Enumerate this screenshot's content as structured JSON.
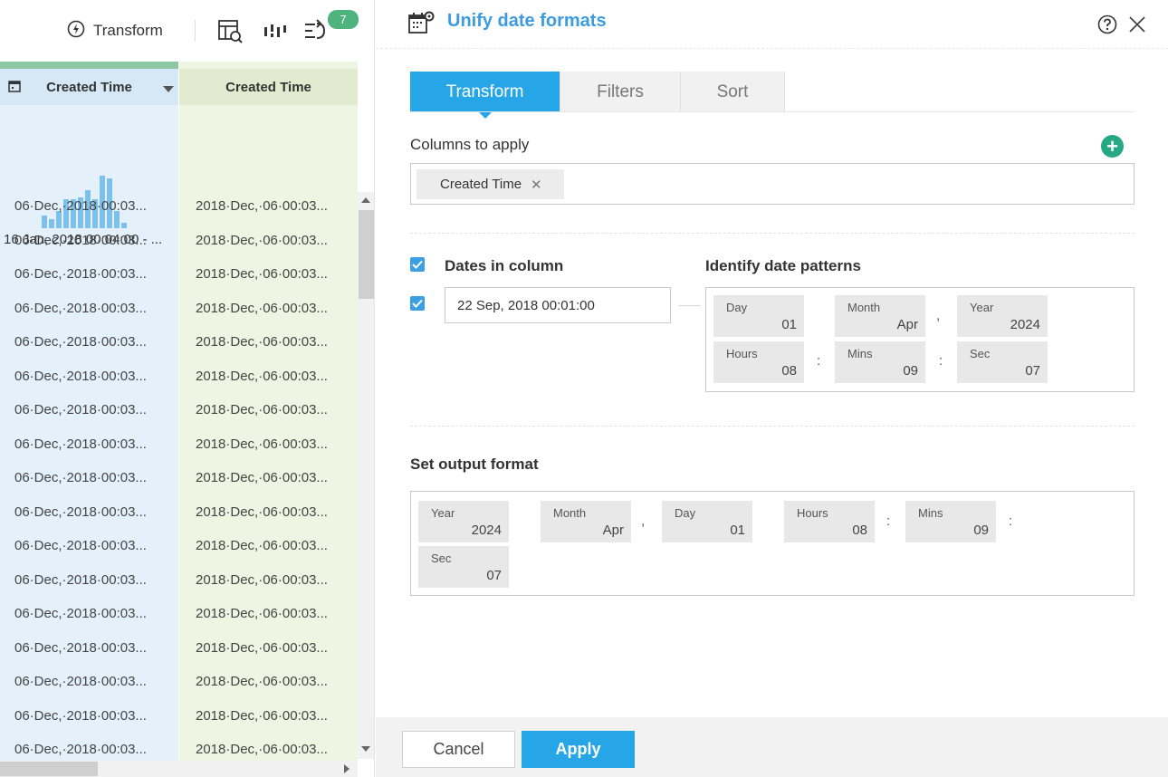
{
  "toolbar": {
    "transform_label": "Transform",
    "badge_count": "7"
  },
  "grid": {
    "col1_header": "Created Time",
    "col2_header": "Created Time",
    "histogram_range": "16 Jan, 2018 00:04:00 - ...",
    "histogram_bars": [
      0.24,
      0.18,
      0.32,
      0.55,
      0.55,
      0.58,
      0.72,
      0.55,
      1.0,
      0.95,
      0.32,
      0.1
    ],
    "col1_cell": "06·Dec,·2018·00:03...",
    "col2_cell": "2018·Dec,·06·00:03...",
    "rows": [
      {
        "c1": "06·Dec,·2018·00:03...",
        "c2": "2018·Dec,·06·00:03..."
      },
      {
        "c1": "06·Dec,·2018·00:03...",
        "c2": "2018·Dec,·06·00:03..."
      },
      {
        "c1": "06·Dec,·2018·00:03...",
        "c2": "2018·Dec,·06·00:03..."
      },
      {
        "c1": "06·Dec,·2018·00:03...",
        "c2": "2018·Dec,·06·00:03..."
      },
      {
        "c1": "06·Dec,·2018·00:03...",
        "c2": "2018·Dec,·06·00:03..."
      },
      {
        "c1": "06·Dec,·2018·00:03...",
        "c2": "2018·Dec,·06·00:03..."
      },
      {
        "c1": "06·Dec,·2018·00:03...",
        "c2": "2018·Dec,·06·00:03..."
      },
      {
        "c1": "06·Dec,·2018·00:03...",
        "c2": "2018·Dec,·06·00:03..."
      },
      {
        "c1": "06·Dec,·2018·00:03...",
        "c2": "2018·Dec,·06·00:03..."
      },
      {
        "c1": "06·Dec,·2018·00:03...",
        "c2": "2018·Dec,·06·00:03..."
      },
      {
        "c1": "06·Dec,·2018·00:03...",
        "c2": "2018·Dec,·06·00:03..."
      },
      {
        "c1": "06·Dec,·2018·00:03...",
        "c2": "2018·Dec,·06·00:03..."
      },
      {
        "c1": "06·Dec,·2018·00:03...",
        "c2": "2018·Dec,·06·00:03..."
      },
      {
        "c1": "06·Dec,·2018·00:03...",
        "c2": "2018·Dec,·06·00:03..."
      },
      {
        "c1": "06·Dec,·2018·00:03...",
        "c2": "2018·Dec,·06·00:03..."
      },
      {
        "c1": "06·Dec,·2018·00:03...",
        "c2": "2018·Dec,·06·00:03..."
      },
      {
        "c1": "06·Dec,·2018·00:03...",
        "c2": "2018·Dec,·06·00:03..."
      }
    ]
  },
  "panel": {
    "title": "Unify date formats",
    "tabs": [
      {
        "label": "Transform"
      },
      {
        "label": "Filters"
      },
      {
        "label": "Sort"
      }
    ],
    "columns_label": "Columns to apply",
    "chip_label": "Created Time",
    "dates_label": "Dates in column",
    "identify_label": "Identify date patterns",
    "sample_value": "22 Sep, 2018 00:01:00",
    "pattern": [
      {
        "label": "Day",
        "value": "01"
      },
      {
        "label": "Month",
        "value": "Apr"
      },
      {
        "label": "Year",
        "value": "2024"
      },
      {
        "label": "Hours",
        "value": "08"
      },
      {
        "label": "Mins",
        "value": "09"
      },
      {
        "label": "Sec",
        "value": "07"
      }
    ],
    "output_label": "Set output format",
    "output": [
      {
        "label": "Year",
        "value": "2024"
      },
      {
        "label": "Month",
        "value": "Apr"
      },
      {
        "label": "Day",
        "value": "01"
      },
      {
        "label": "Hours",
        "value": "08"
      },
      {
        "label": "Mins",
        "value": "09"
      },
      {
        "label": "Sec",
        "value": "07"
      }
    ],
    "comma": ",",
    "colon": ":",
    "cancel_label": "Cancel",
    "apply_label": "Apply"
  },
  "colors": {
    "accent": "#26a6e6",
    "add_button": "#25a883",
    "badge": "#4fb37e"
  }
}
